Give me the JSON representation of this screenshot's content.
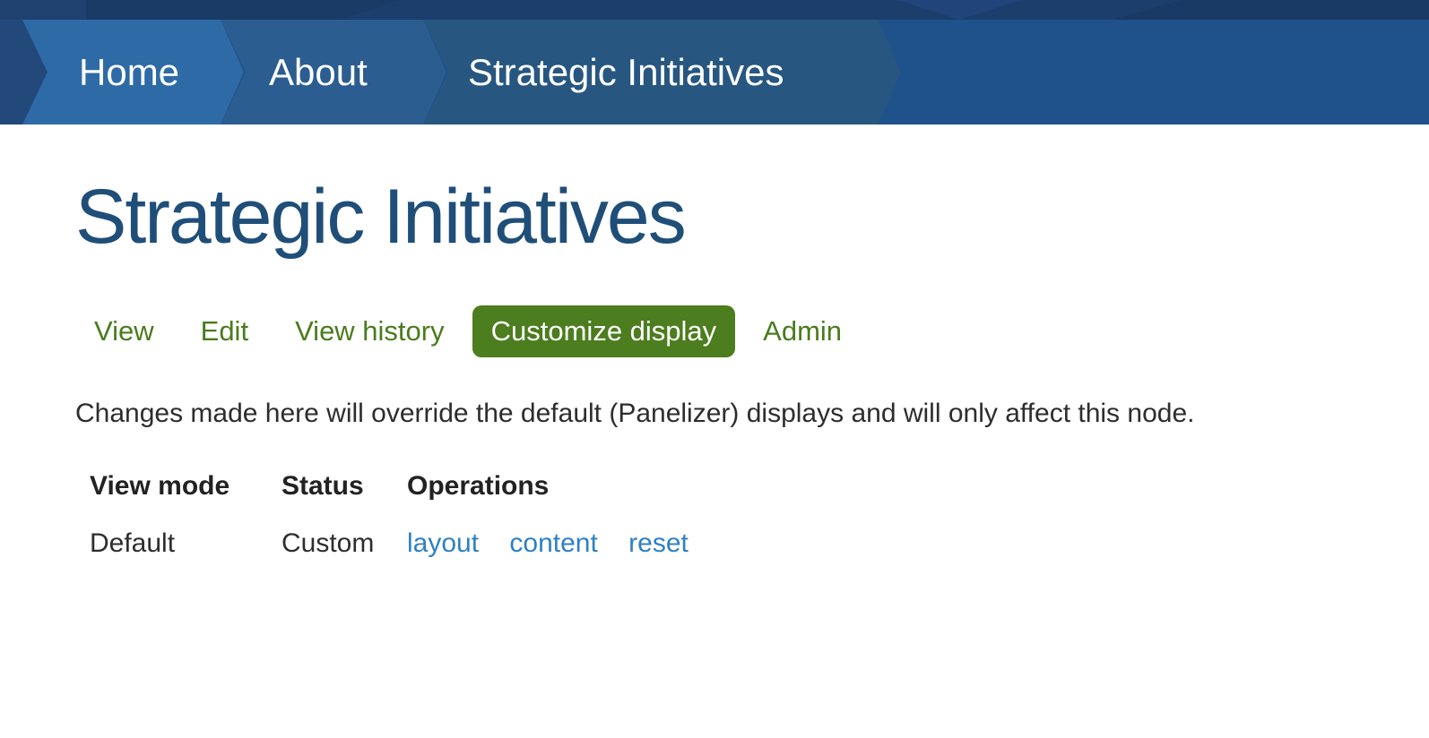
{
  "breadcrumb": {
    "items": [
      {
        "label": "Home"
      },
      {
        "label": "About"
      },
      {
        "label": "Strategic Initiatives"
      }
    ]
  },
  "page": {
    "title": "Strategic Initiatives",
    "message": "Changes made here will override the default (Panelizer) displays and will only affect this node."
  },
  "tabs": [
    {
      "label": "View",
      "active": false
    },
    {
      "label": "Edit",
      "active": false
    },
    {
      "label": "View history",
      "active": false
    },
    {
      "label": "Customize display",
      "active": true
    },
    {
      "label": "Admin",
      "active": false
    }
  ],
  "table": {
    "headers": [
      "View mode",
      "Status",
      "Operations"
    ],
    "rows": [
      {
        "view_mode": "Default",
        "status": "Custom",
        "operations": [
          "layout",
          "content",
          "reset"
        ]
      }
    ]
  },
  "colors": {
    "top_strip": "#1c3e6c",
    "breadcrumb_base": "#1f518b",
    "crumb_home": "#2e6ba6",
    "crumb_about": "#2b5d90",
    "crumb_current": "#275781",
    "title_blue": "#1f4e79",
    "tab_green": "#4a7b1e",
    "active_tab_bg": "#4c7d1e",
    "link_blue": "#2f80c3"
  }
}
